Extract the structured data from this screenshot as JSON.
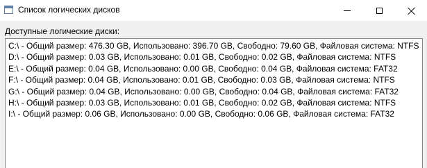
{
  "window": {
    "title": "Список логических дисков"
  },
  "label": "Доступные логические диски:",
  "drives": [
    "C:\\ - Общий размер: 476.30 GB, Использовано: 396.70 GB, Свободно: 79.60 GB, Файловая система: NTFS",
    "D:\\ - Общий размер: 0.03 GB, Использовано: 0.01 GB, Свободно: 0.02 GB, Файловая система: NTFS",
    "E:\\ - Общий размер: 0.04 GB, Использовано: 0.00 GB, Свободно: 0.04 GB, Файловая система: FAT32",
    "F:\\ - Общий размер: 0.04 GB, Использовано: 0.01 GB, Свободно: 0.03 GB, Файловая система: NTFS",
    "G:\\ - Общий размер: 0.04 GB, Использовано: 0.00 GB, Свободно: 0.04 GB, Файловая система: FAT32",
    "H:\\ - Общий размер: 0.03 GB, Использовано: 0.01 GB, Свободно: 0.02 GB, Файловая система: NTFS",
    "I:\\ - Общий размер: 0.06 GB, Использовано: 0.00 GB, Свободно: 0.06 GB, Файловая система: FAT32"
  ],
  "icons": {
    "app": "window-icon",
    "minimize": "minimize-icon",
    "maximize": "maximize-icon",
    "close": "close-icon"
  }
}
